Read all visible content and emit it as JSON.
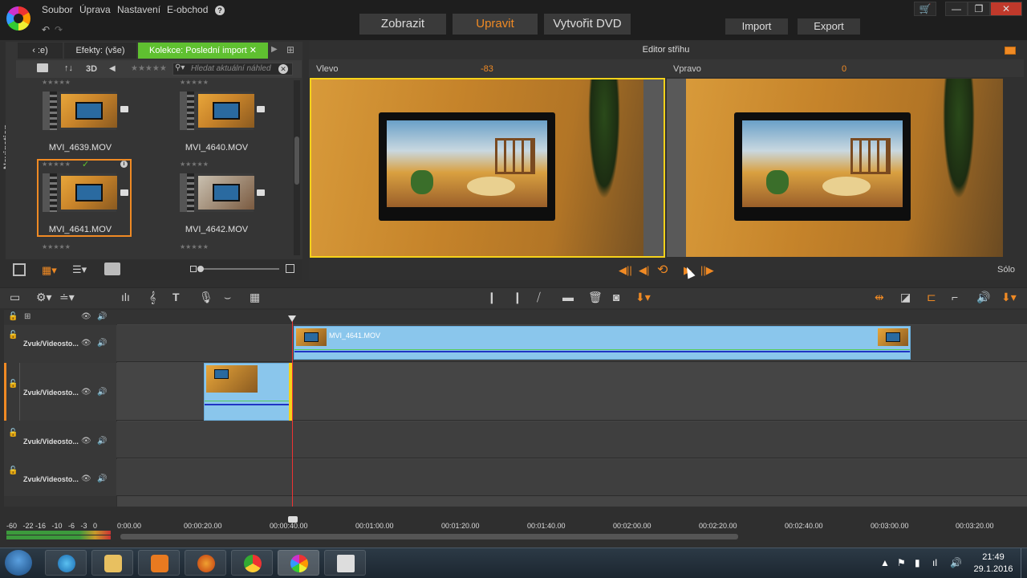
{
  "menu": {
    "file": "Soubor",
    "edit": "Úprava",
    "settings": "Nastavení",
    "eshop": "E-obchod",
    "help": "?"
  },
  "modes": {
    "view": "Zobrazit",
    "edit": "Upravit",
    "dvd": "Vytvořit DVD"
  },
  "io": {
    "import": "Import",
    "export": "Export"
  },
  "window": {
    "cart": "🛒",
    "minimize": "—",
    "restore": "❐",
    "close": "✕"
  },
  "library": {
    "nav_label": "Navigation",
    "tabs": [
      {
        "label": "‹ :e)"
      },
      {
        "label": "Efekty: (vše)"
      },
      {
        "label": "Kolekce: Poslední import ✕"
      }
    ],
    "toolbar": {
      "sort": "↑↓",
      "3d": "3D",
      "stars": "★★★★★"
    },
    "search_placeholder": "Hledat aktuální náhled",
    "clips": [
      {
        "name": "MVI_4639.MOV"
      },
      {
        "name": "MVI_4640.MOV"
      },
      {
        "name": "MVI_4641.MOV"
      },
      {
        "name": "MVI_4642.MOV"
      }
    ],
    "star_row": "★★★★★"
  },
  "editor": {
    "title": "Editor střihu",
    "left_label": "Vlevo",
    "left_value": "-83",
    "right_label": "Vpravo",
    "right_value": "0",
    "solo": "Sólo",
    "controls": {
      "prev": "◀||",
      "back": "◀|",
      "loop": "⟲",
      "play": "▶",
      "next": "||▶"
    }
  },
  "timeline": {
    "tracks": [
      {
        "name": "Zvuk/Videosto..."
      },
      {
        "name": "Zvuk/Videosto..."
      },
      {
        "name": "Zvuk/Videosto..."
      },
      {
        "name": "Zvuk/Videosto..."
      }
    ],
    "clip_name": "MVI_4641.MOV",
    "ruler": [
      "0:00.00",
      "00:00:20.00",
      "00:00:40.00",
      "00:01:00.00",
      "00:01:20.00",
      "00:01:40.00",
      "00:02:00.00",
      "00:02:20.00",
      "00:02:40.00",
      "00:03:00.00",
      "00:03:20.00"
    ],
    "vu_scale": "-60   -22 -16   -10   -6   -3   0"
  },
  "taskbar": {
    "time": "21:49",
    "date": "29.1.2016"
  },
  "colors": {
    "accent": "#f08a24",
    "selected_tab": "#5fc030",
    "clip": "#8ac6ec",
    "frame": "#f6d21a"
  }
}
